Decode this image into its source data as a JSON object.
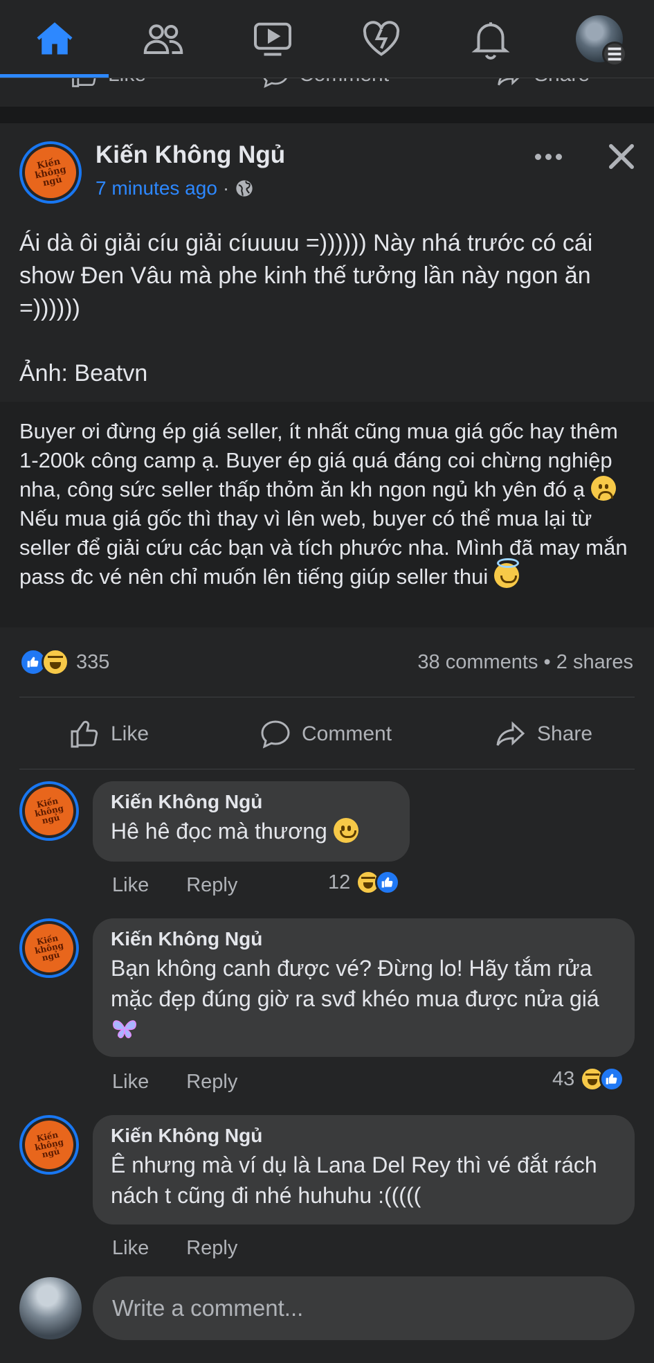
{
  "nav": {
    "items": [
      {
        "icon": "home-icon",
        "active": true
      },
      {
        "icon": "friends-icon",
        "active": false
      },
      {
        "icon": "watch-icon",
        "active": false
      },
      {
        "icon": "dating-icon",
        "active": false
      },
      {
        "icon": "bell-icon",
        "active": false
      },
      {
        "icon": "profile-menu-icon",
        "active": false
      }
    ],
    "accent_color": "#2d88ff"
  },
  "previous_post_actions": {
    "like": "Like",
    "comment": "Comment",
    "share": "Share"
  },
  "post": {
    "page_name": "Kiến Không Ngủ",
    "avatar_text": [
      "Kiến",
      "không",
      "ngủ"
    ],
    "timestamp": "7 minutes ago",
    "separator": "·",
    "privacy_icon": "globe-icon",
    "text": "Ái dà ôi giải cíu giải cíuuuu =)))))) Này nhá trước có cái show Đen Vâu mà phe kinh thế tưởng lần này ngon ăn =))))))\n\nẢnh: Beatvn",
    "caption_part1": "Buyer ơi đừng ép giá seller, ít nhất cũng mua giá gốc hay thêm 1-200k công camp ạ. Buyer ép giá quá đáng coi chừng nghiệp nha, công sức seller thấp thỏm ăn kh ngon ngủ kh yên đó ạ ",
    "caption_part2": " Nếu mua giá gốc thì thay vì lên web, buyer có thể mua lại từ seller để giải cứu các bạn và tích phước nha. Mình đã may mắn pass đc vé nên chỉ muốn lên tiếng giúp seller thui ",
    "reaction_count": "335",
    "comments_count": "38 comments",
    "shares_count": "2 shares",
    "stats_separator": "•",
    "actions": {
      "like": "Like",
      "comment": "Comment",
      "share": "Share"
    }
  },
  "comments": [
    {
      "author": "Kiến Không Ngủ",
      "text": "Hê hê đọc mà thương ",
      "like": "Like",
      "reply": "Reply",
      "reaction_count": "12"
    },
    {
      "author": "Kiến Không Ngủ",
      "text": "Bạn không canh được vé? Đừng lo! Hãy tắm rửa mặc đẹp đúng giờ ra svđ khéo mua được nửa giá ",
      "like": "Like",
      "reply": "Reply",
      "reaction_count": "43"
    },
    {
      "author": "Kiến Không Ngủ",
      "text": "Ê nhưng mà ví dụ là Lana Del Rey thì vé đắt rách nách t cũng đi nhé huhuhu :(((((",
      "like": "Like",
      "reply": "Reply",
      "reaction_count": ""
    }
  ],
  "composer": {
    "placeholder": "Write a comment..."
  }
}
